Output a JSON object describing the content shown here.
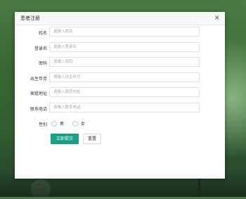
{
  "dialog": {
    "title": "患者注册",
    "close_symbol": "×"
  },
  "form": {
    "fields": [
      {
        "label": "姓名",
        "placeholder": "请输入姓名"
      },
      {
        "label": "登录名",
        "placeholder": "请输入登录名"
      },
      {
        "label": "密码",
        "placeholder": "请输入密码"
      },
      {
        "label": "出生年月",
        "placeholder": "请输入出生年月"
      },
      {
        "label": "家庭地址",
        "placeholder": "请输入家庭地址"
      },
      {
        "label": "联系电话",
        "placeholder": "请输入联系电话"
      }
    ],
    "gender": {
      "label": "性别",
      "options": [
        "男",
        "女"
      ]
    },
    "submit_label": "立即提交",
    "reset_label": "重置"
  },
  "colors": {
    "primary": "#16a085"
  }
}
